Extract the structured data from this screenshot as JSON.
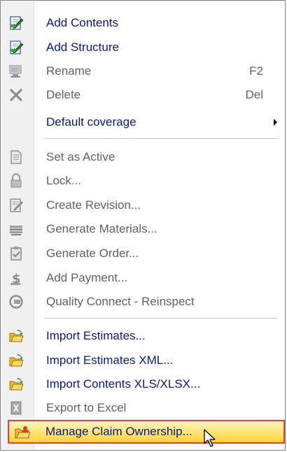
{
  "menu": {
    "items": [
      {
        "label": "Add Contents",
        "icon": "add-contents-icon",
        "enabled": true
      },
      {
        "label": "Add Structure",
        "icon": "add-structure-icon",
        "enabled": true
      },
      {
        "label": "Rename",
        "shortcut": "F2",
        "icon": "rename-icon",
        "enabled": false
      },
      {
        "label": "Delete",
        "shortcut": "Del",
        "icon": "delete-icon",
        "enabled": false
      },
      {
        "label": "Default coverage",
        "icon": "none",
        "enabled": true,
        "submenu": true
      },
      {
        "label": "Set as Active",
        "icon": "document-icon",
        "enabled": false
      },
      {
        "label": "Lock...",
        "icon": "lock-icon",
        "enabled": false
      },
      {
        "label": "Create Revision...",
        "icon": "revision-icon",
        "enabled": false
      },
      {
        "label": "Generate Materials...",
        "icon": "materials-icon",
        "enabled": false
      },
      {
        "label": "Generate Order...",
        "icon": "order-icon",
        "enabled": false
      },
      {
        "label": "Add Payment...",
        "icon": "payment-icon",
        "enabled": false
      },
      {
        "label": "Quality Connect - Reinspect",
        "icon": "reinspect-icon",
        "enabled": false
      },
      {
        "label": "Import Estimates...",
        "icon": "open-folder-icon",
        "enabled": true
      },
      {
        "label": "Import Estimates XML...",
        "icon": "open-folder-icon",
        "enabled": true
      },
      {
        "label": "Import Contents XLS/XLSX...",
        "icon": "open-folder-icon",
        "enabled": true
      },
      {
        "label": "Export to Excel",
        "icon": "excel-icon",
        "enabled": false
      },
      {
        "label": "Manage Claim Ownership...",
        "icon": "claim-ownership-icon",
        "enabled": true,
        "highlighted": true
      }
    ]
  },
  "colors": {
    "enabled_text": "#0a1a72",
    "disabled_text": "#5f6168",
    "highlight_border": "#e04040",
    "highlight_fill": "#ffd23a"
  }
}
